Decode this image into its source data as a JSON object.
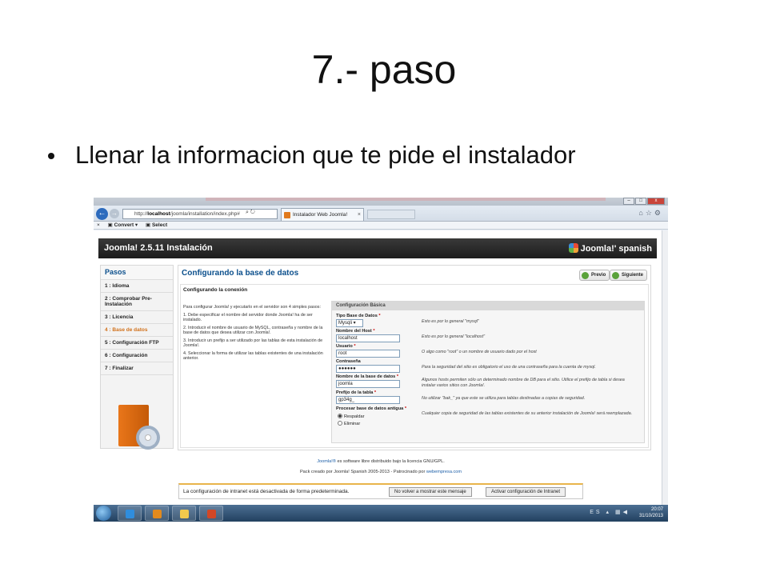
{
  "slide": {
    "title": "7.- paso",
    "bullet": "Llenar la informacion que te pide el instalador"
  },
  "browser": {
    "url_prefix": "http://",
    "url_host": "localhost",
    "url_path": "/joomla/installation/index.php#",
    "tab_title": "Instalador Web Joomla!",
    "cmd_convert": "Convert",
    "cmd_select": "Select"
  },
  "joomla": {
    "header_title": "Joomla! 2.5.11 Instalación",
    "logo_text": "Joomla!' spanish",
    "sidebar_title": "Pasos",
    "steps": [
      "1 : Idioma",
      "2 : Comprobar Pre-Instalación",
      "3 : Licencia",
      "4 : Base de datos",
      "5 : Configuración FTP",
      "6 : Configuración",
      "7 : Finalizar"
    ],
    "main_title": "Configurando la base de datos",
    "btn_prev": "Previo",
    "btn_next": "Siguiente",
    "subpanel_title": "Configurando la conexión",
    "intro": [
      "Para configurar Joomla! y ejecutarlo en el servidor son 4 simples pasos:",
      "1. Debe especificar el nombre del servidor donde Joomla! ha de ser instalado.",
      "2. Introducir el nombre de usuario de MySQL, contraseña y nombre de la base de datos que desea utilizar con Joomla!.",
      "3. Introducir un prefijo a ser utilizado por las tablas de esta instalación de Joomla!.",
      "4. Seleccionar la forma de utilizar las tablas existentes de una instalación anterior."
    ],
    "config_title": "Configuración Básica",
    "fields": {
      "db_type_label": "Tipo Base de Datos",
      "db_type_value": "Mysqli",
      "db_type_hint": "Esto es por lo general \"mysql\"",
      "host_label": "Nombre del Host",
      "host_value": "localhost",
      "host_hint": "Esto es por lo general \"localhost\"",
      "user_label": "Usuario",
      "user_value": "root",
      "user_hint": "O algo como \"root\" o un nombre de usuario dado por el host",
      "pass_label": "Contraseña",
      "pass_value": "●●●●●●",
      "pass_hint": "Para la seguridad del sitio es obligatorio el uso de una contraseña para la cuenta de mysql.",
      "dbname_label": "Nombre de la base de datos",
      "dbname_value": "joomla",
      "dbname_hint": "Algunos hosts permiten sólo un determinado nombre de DB para el sitio. Utilice el prefijo de tabla si desea instalar varios sitios con Joomla!.",
      "prefix_label": "Prefijo de la tabla",
      "prefix_value": "gp34g_",
      "prefix_hint": "No utilizar \"bak_\" ya que este se utiliza para tablas destinadas a copias de seguridad.",
      "old_label": "Procesar base de datos antigua",
      "old_opt1": "Respaldar",
      "old_opt2": "Eliminar",
      "old_hint": "Cualquier copia de seguridad de las tablas existentes de su anterior instalación de Joomla! será reemplazada."
    },
    "required_mark": "*",
    "footer1_link": "Joomla!®",
    "footer1_text": " es software libre distribuido bajo la licencia GNU/GPL.",
    "footer2_text": "Pack creado por Joomla! Spanish 2005-2013 - Patrocinado por ",
    "footer2_link": "webempresa.com"
  },
  "notification": {
    "message": "La configuración de intranet está desactivada de forma predeterminada.",
    "btn_dismiss": "No volver a mostrar este mensaje",
    "btn_activate": "Activar configuración de Intranet"
  },
  "taskbar": {
    "lang": "ES",
    "time": "20:07",
    "date": "31/10/2013"
  },
  "colors": {
    "joomla_blue": "#0b4f8c",
    "active_step": "#d1701a",
    "header_dark": "#1c1c1c"
  }
}
